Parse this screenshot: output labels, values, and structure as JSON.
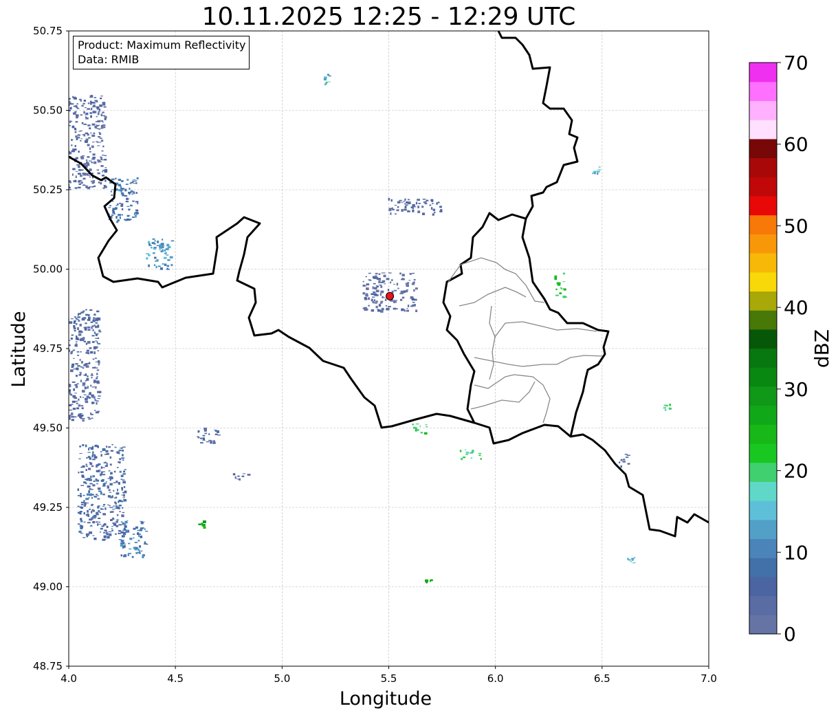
{
  "title": "10.11.2025 12:25 - 12:29 UTC",
  "info": {
    "product": "Product: Maximum Reflectivity",
    "data": "Data: RMIB"
  },
  "chart_data": {
    "type": "heatmap",
    "title": "10.11.2025 12:25 - 12:29 UTC",
    "xlabel": "Longitude",
    "ylabel": "Latitude",
    "xlim": [
      4.0,
      7.0
    ],
    "ylim": [
      48.75,
      50.75
    ],
    "x_ticks": [
      "4.0",
      "4.5",
      "5.0",
      "5.5",
      "6.0",
      "6.5",
      "7.0"
    ],
    "y_ticks": [
      "48.75",
      "49.00",
      "49.25",
      "49.50",
      "49.75",
      "50.00",
      "50.25",
      "50.50",
      "50.75"
    ],
    "grid": true,
    "radar_site": {
      "lon": 5.505,
      "lat": 49.915,
      "color": "#e8141a"
    },
    "colorbar": {
      "label": "dBZ",
      "min": 0,
      "max": 70,
      "tick_labels": [
        "0",
        "10",
        "20",
        "30",
        "40",
        "50",
        "60",
        "70"
      ],
      "colors": [
        "#6674a5",
        "#5a6ca4",
        "#4b64a2",
        "#4270a8",
        "#4a84b8",
        "#52a0c8",
        "#5ec0d8",
        "#60d8c8",
        "#40d070",
        "#18c820",
        "#18b818",
        "#10a818",
        "#109818",
        "#088810",
        "#077810",
        "#065808",
        "#487808",
        "#a8a808",
        "#f8d808",
        "#f8b808",
        "#f89808",
        "#f87808",
        "#e80808",
        "#c00808",
        "#a80808",
        "#780808",
        "#ffe0ff",
        "#ffb0ff",
        "#ff70ff",
        "#f030f0"
      ]
    },
    "echoes": [
      {
        "lon": 4.08,
        "lat": 50.4,
        "w": 0.18,
        "h": 0.3,
        "dbz": 3
      },
      {
        "lon": 4.25,
        "lat": 50.22,
        "w": 0.14,
        "h": 0.14,
        "dbz": 8
      },
      {
        "lon": 4.42,
        "lat": 50.05,
        "w": 0.12,
        "h": 0.1,
        "dbz": 12
      },
      {
        "lon": 4.06,
        "lat": 49.7,
        "w": 0.16,
        "h": 0.35,
        "dbz": 4
      },
      {
        "lon": 4.15,
        "lat": 49.3,
        "w": 0.22,
        "h": 0.3,
        "dbz": 6
      },
      {
        "lon": 4.3,
        "lat": 49.15,
        "w": 0.12,
        "h": 0.12,
        "dbz": 10
      },
      {
        "lon": 4.65,
        "lat": 49.48,
        "w": 0.1,
        "h": 0.05,
        "dbz": 5
      },
      {
        "lon": 4.8,
        "lat": 49.35,
        "w": 0.08,
        "h": 0.02,
        "dbz": 4
      },
      {
        "lon": 5.5,
        "lat": 49.93,
        "w": 0.25,
        "h": 0.12,
        "dbz": 2
      },
      {
        "lon": 5.62,
        "lat": 50.2,
        "w": 0.25,
        "h": 0.05,
        "dbz": 3
      },
      {
        "lon": 5.88,
        "lat": 49.42,
        "w": 0.1,
        "h": 0.03,
        "dbz": 20
      },
      {
        "lon": 5.65,
        "lat": 49.5,
        "w": 0.1,
        "h": 0.03,
        "dbz": 22
      },
      {
        "lon": 6.3,
        "lat": 49.95,
        "w": 0.05,
        "h": 0.08,
        "dbz": 22
      },
      {
        "lon": 6.47,
        "lat": 50.31,
        "w": 0.04,
        "h": 0.03,
        "dbz": 14
      },
      {
        "lon": 6.8,
        "lat": 49.56,
        "w": 0.03,
        "h": 0.04,
        "dbz": 20
      },
      {
        "lon": 6.63,
        "lat": 49.08,
        "w": 0.04,
        "h": 0.03,
        "dbz": 14
      },
      {
        "lon": 5.21,
        "lat": 50.6,
        "w": 0.04,
        "h": 0.03,
        "dbz": 15
      },
      {
        "lon": 5.68,
        "lat": 49.02,
        "w": 0.04,
        "h": 0.01,
        "dbz": 28
      },
      {
        "lon": 4.62,
        "lat": 49.2,
        "w": 0.03,
        "h": 0.02,
        "dbz": 26
      },
      {
        "lon": 6.6,
        "lat": 49.4,
        "w": 0.05,
        "h": 0.04,
        "dbz": 5
      }
    ]
  }
}
